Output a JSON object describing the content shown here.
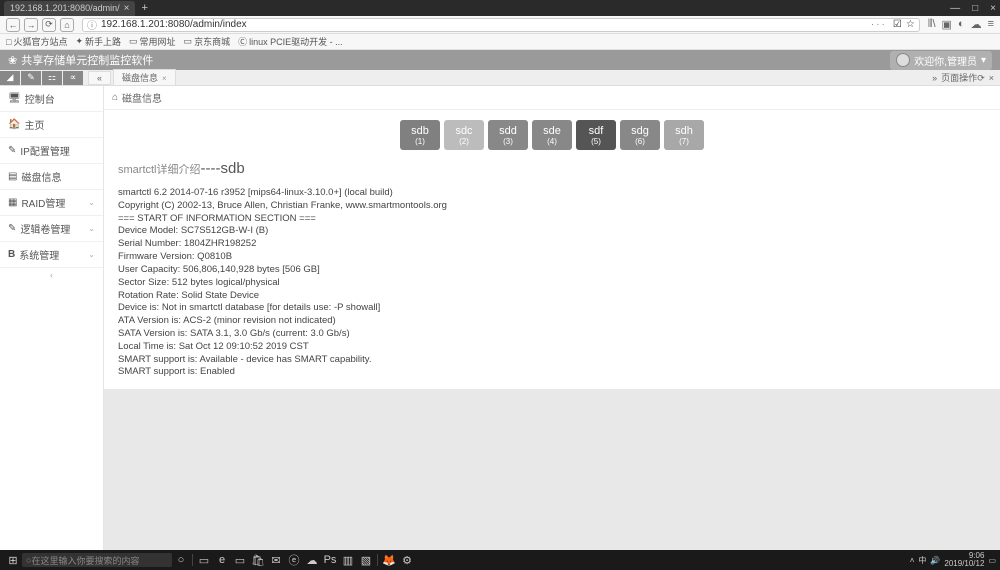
{
  "browser": {
    "tab_title": "192.168.1.201:8080/admin/",
    "url": "192.168.1.201:8080/admin/index",
    "url_dots": "···",
    "bookmarks": [
      "火狐官方站点",
      "新手上路",
      "常用网址",
      "京东商城",
      "linux PCIE驱动开发 - ..."
    ]
  },
  "app": {
    "title": "共享存储单元控制监控软件",
    "user": "欢迎你,管理员"
  },
  "tabs": {
    "info": "磁盘信息"
  },
  "right_tool": "页面操作",
  "sidebar": {
    "items": [
      {
        "icon": "🖥",
        "label": "控制台"
      },
      {
        "icon": "🏠",
        "label": "主页"
      },
      {
        "icon": "✎",
        "label": "IP配置管理"
      },
      {
        "icon": "▤",
        "label": "磁盘信息"
      },
      {
        "icon": "▦",
        "label": "RAID管理",
        "chev": true
      },
      {
        "icon": "✎",
        "label": "逻辑卷管理",
        "chev": true
      },
      {
        "icon": "B",
        "label": "系统管理",
        "chev": true
      }
    ]
  },
  "breadcrumb": {
    "home": "⌂",
    "label": "磁盘信息"
  },
  "disks": [
    {
      "name": "sdb",
      "num": "(1)",
      "cls": "dt-active"
    },
    {
      "name": "sdc",
      "num": "(2)",
      "cls": "dt-light"
    },
    {
      "name": "sdd",
      "num": "(3)",
      "cls": "dt-med"
    },
    {
      "name": "sde",
      "num": "(4)",
      "cls": "dt-med"
    },
    {
      "name": "sdf",
      "num": "(5)",
      "cls": "dt-dark"
    },
    {
      "name": "sdg",
      "num": "(6)",
      "cls": "dt-med"
    },
    {
      "name": "sdh",
      "num": "(7)",
      "cls": "dt-lighter"
    }
  ],
  "smart": {
    "title_prefix": "smartctl详细介绍",
    "title_sep": "----",
    "title_disk": "sdb",
    "lines": [
      "smartctl 6.2 2014-07-16 r3952 [mips64-linux-3.10.0+] (local build)",
      "Copyright (C) 2002-13, Bruce Allen, Christian Franke, www.smartmontools.org",
      "",
      "=== START OF INFORMATION SECTION ===",
      "Device Model: SC7S512GB-W-I (B)",
      "Serial Number: 1804ZHR198252",
      "Firmware Version: Q0810B",
      "User Capacity: 506,806,140,928 bytes [506 GB]",
      "Sector Size: 512 bytes logical/physical",
      "Rotation Rate: Solid State Device",
      "Device is: Not in smartctl database [for details use: -P showall]",
      "ATA Version is: ACS-2 (minor revision not indicated)",
      "SATA Version is: SATA 3.1, 3.0 Gb/s (current: 3.0 Gb/s)",
      "Local Time is: Sat Oct 12 09:10:52 2019 CST",
      "SMART support is: Available - device has SMART capability.",
      "SMART support is: Enabled"
    ]
  },
  "taskbar": {
    "search_placeholder": "在这里输入你要搜索的内容",
    "time": "9:06",
    "date": "2019/10/12"
  }
}
